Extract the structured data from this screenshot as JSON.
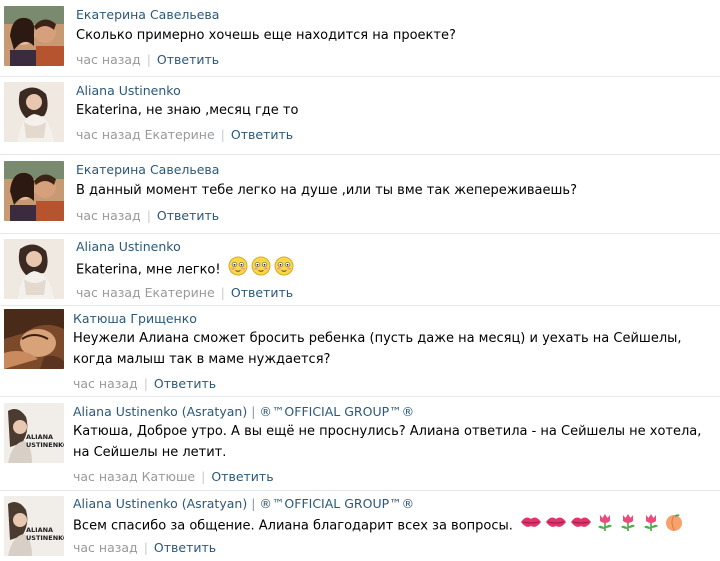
{
  "comments": [
    {
      "author": "Екатерина Савельева",
      "text": "Сколько примерно хочешь еще находится на проекте?",
      "time": "час назад",
      "reply": "Ответить"
    },
    {
      "author": "Aliana Ustinenko",
      "text": "Ekaterina, не знаю ,месяц где то",
      "time": "час назад Екатерине",
      "reply": "Ответить"
    },
    {
      "author": "Екатерина Савельева",
      "text": "В данный момент тебе легко на душе ,или ты вме так жепереживаешь?",
      "time": "час назад",
      "reply": "Ответить"
    },
    {
      "author": "Aliana Ustinenko",
      "text": "Ekaterina, мне легко!",
      "emojis": [
        "blushing-face-icon",
        "blushing-face-icon",
        "blushing-face-icon"
      ],
      "time": "час назад Екатерине",
      "reply": "Ответить"
    },
    {
      "author": "Катюша Грищенко",
      "text_line1": "Неужели Алиана сможет бросить ребенка (пусть даже на месяц) и уехать на Сейшелы,",
      "text_line2": "когда малыш так в маме нуждается?",
      "time": "час назад",
      "reply": "Ответить"
    },
    {
      "author": "Aliana Ustinenko (Asratyan)",
      "group": "®™OFFICIAL GROUP™®",
      "text_line1": "Катюша, Доброе утро. А вы ещё не проснулись? Алиана ответила - на Сейшелы не хотела,",
      "text_line2": "на Сейшелы не летит.",
      "time": "час назад Катюше",
      "reply": "Ответить"
    },
    {
      "author": "Aliana Ustinenko (Asratyan)",
      "group": "®™OFFICIAL GROUP™®",
      "text": "Всем спасибо за общение. Алиана благодарит всех за вопросы.",
      "emojis": [
        "kiss-lips-icon",
        "kiss-lips-icon",
        "kiss-lips-icon",
        "tulip-icon",
        "tulip-icon",
        "tulip-icon",
        "peach-icon"
      ],
      "time": "час назад",
      "reply": "Ответить"
    }
  ],
  "avatar_badge": {
    "line1": "ALIANA",
    "line2": "USTINENKO"
  },
  "colors": {
    "link": "#2b587a",
    "meta": "#999999",
    "divider": "#e7eaed"
  }
}
